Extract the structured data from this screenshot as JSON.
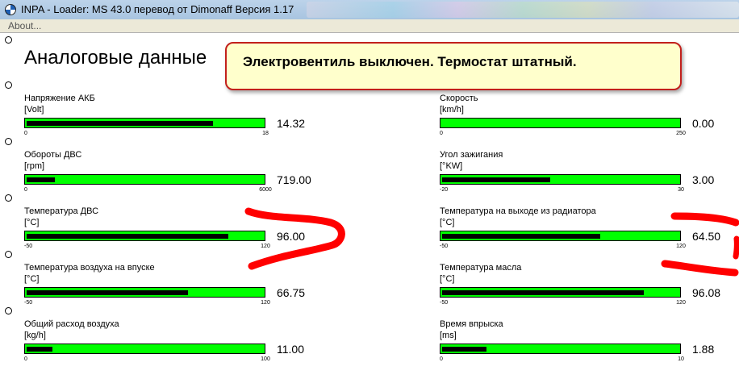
{
  "window": {
    "title": "INPA - Loader:  MS 43.0 перевод от Dimonaff Версия 1.17"
  },
  "menu": {
    "about": "About..."
  },
  "page": {
    "title": "Аналоговые данные"
  },
  "popup": {
    "message": "Электровентиль выключен. Термостат штатный."
  },
  "colors": {
    "bar_bg": "#00ff00",
    "bar_fill": "#000000",
    "popup_bg": "#ffffcc",
    "popup_border": "#c2201c",
    "annotation": "#ff0000"
  },
  "gauges": [
    {
      "label": "Напряжение АКБ",
      "unit": "[Volt]",
      "min": "0",
      "max": "18",
      "value": "14.32",
      "fill": 0.795
    },
    {
      "label": "Скорость",
      "unit": "[km/h]",
      "min": "0",
      "max": "250",
      "value": "0.00",
      "fill": 0.0
    },
    {
      "label": "Обороты ДВС",
      "unit": "[rpm]",
      "min": "0",
      "max": "6000",
      "value": "719.00",
      "fill": 0.12
    },
    {
      "label": "Угол зажигания",
      "unit": "[°KW]",
      "min": "-20",
      "max": "30",
      "value": "3.00",
      "fill": 0.46
    },
    {
      "label": "Температура ДВС",
      "unit": "[°C]",
      "min": "-50",
      "max": "120",
      "value": "96.00",
      "fill": 0.86
    },
    {
      "label": "Температура на выходе из радиатора",
      "unit": "[°C]",
      "min": "-50",
      "max": "120",
      "value": "64.50",
      "fill": 0.675
    },
    {
      "label": "Температура воздуха на впуске",
      "unit": "[°C]",
      "min": "-50",
      "max": "120",
      "value": "66.75",
      "fill": 0.688
    },
    {
      "label": "Температура масла",
      "unit": "[°C]",
      "min": "-50",
      "max": "120",
      "value": "96.08",
      "fill": 0.86
    },
    {
      "label": "Общий расход воздуха",
      "unit": "[kg/h]",
      "min": "0",
      "max": "100",
      "value": "11.00",
      "fill": 0.11
    },
    {
      "label": "Время впрыска",
      "unit": "[ms]",
      "min": "0",
      "max": "10",
      "value": "1.88",
      "fill": 0.188
    }
  ]
}
